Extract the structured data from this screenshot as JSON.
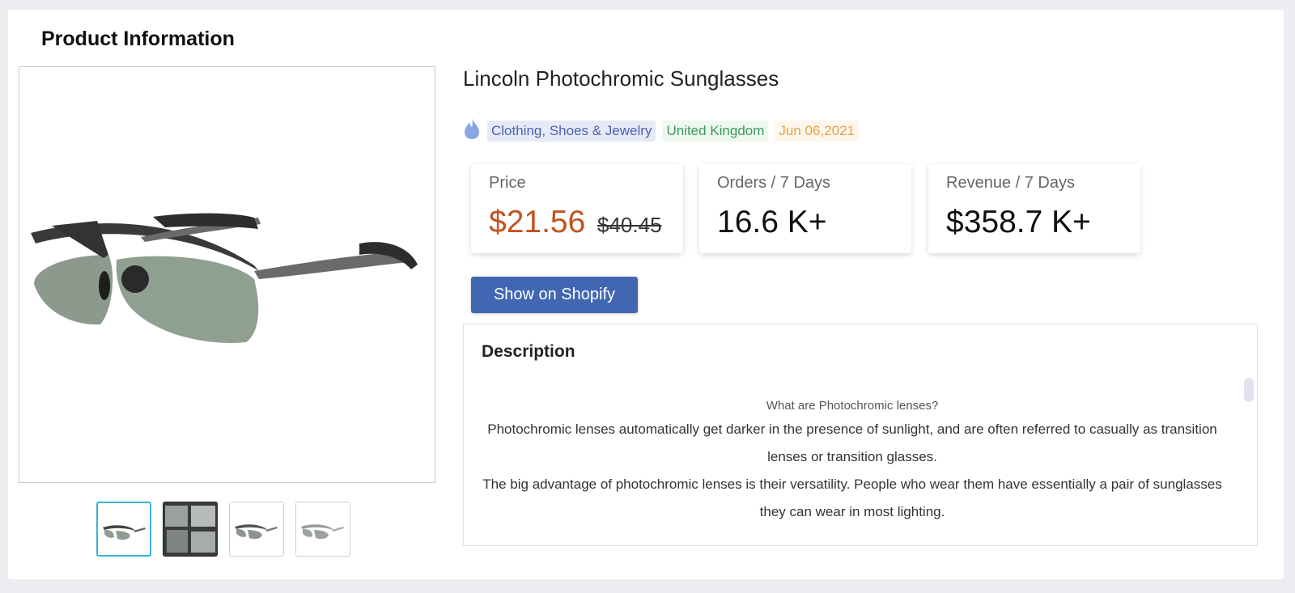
{
  "section_title": "Product Information",
  "product": {
    "title": "Lincoln Photochromic Sunglasses",
    "tags": {
      "icon": "fire-icon",
      "category": "Clothing, Shoes & Jewelry",
      "country": "United Kingdom",
      "date": "Jun 06,2021"
    }
  },
  "stats": {
    "price_label": "Price",
    "price_value": "$21.56",
    "price_old": "$40.45",
    "orders_label": "Orders / 7 Days",
    "orders_value": "16.6 K+",
    "revenue_label": "Revenue / 7 Days",
    "revenue_value": "$358.7 K+"
  },
  "button": {
    "shopify_label": "Show on Shopify"
  },
  "description": {
    "title": "Description",
    "subtitle": "What are Photochromic lenses?",
    "para1": "Photochromic lenses automatically get darker in the presence of sunlight, and are often referred to casually as transition lenses or transition glasses.",
    "para2": "The big advantage of photochromic lenses is their versatility. People who wear them have essentially a pair of sunglasses they can wear in most lighting."
  },
  "colors": {
    "accent": "#4267b2",
    "price": "#c4521e",
    "active_thumb": "#38b3d9"
  }
}
